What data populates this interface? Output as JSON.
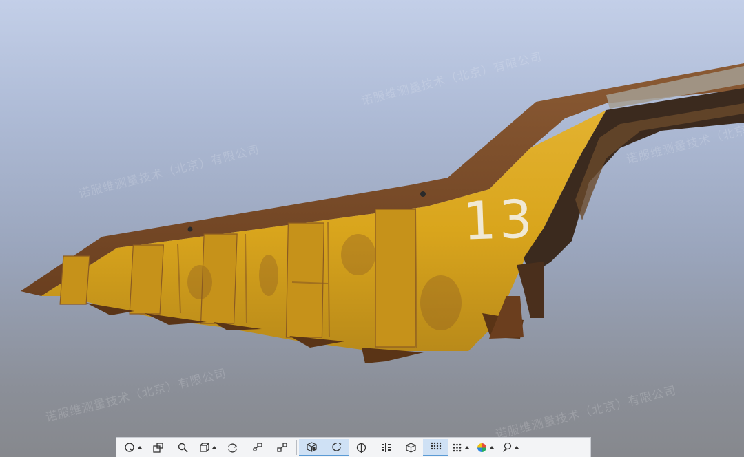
{
  "scene": {
    "object_number": "13",
    "watermark_text": "诺服维测量技术（北京）有限公司",
    "colors": {
      "sky_top": "#c3cfe8",
      "sky_bottom": "#86888d",
      "bed_yellow": "#d9a51c",
      "bed_rust": "#7a4a24",
      "toolbar_bg": "#f3f4f6",
      "active_tab": "#cfe1f5"
    }
  },
  "toolbar": {
    "groups": [
      {
        "id": "navigation",
        "items": [
          "orbit-icon",
          "select-region-icon",
          "zoom-icon",
          "view-cube-icon",
          "rotate-icon",
          "pan-icon",
          "fit-icon"
        ]
      },
      {
        "id": "display",
        "items": [
          "box-view-icon",
          "refresh-view-icon",
          "section-icon",
          "layers-icon",
          "shading-icon",
          "points-icon",
          "point-size-icon",
          "color-mode-icon",
          "style-icon"
        ]
      }
    ],
    "active_items": [
      "box-view-icon",
      "refresh-view-icon",
      "points-icon"
    ]
  }
}
